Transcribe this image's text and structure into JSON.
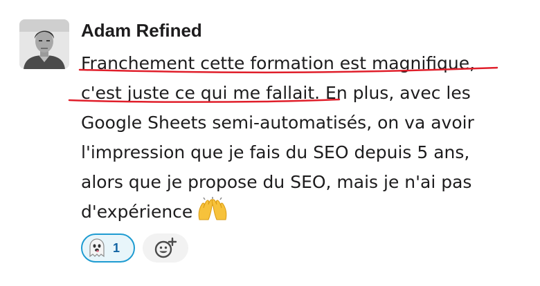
{
  "message": {
    "sender_name": "Adam Refined",
    "lines": [
      "Franchement cette formation est magnifique,",
      "c'est juste ce qui me fallait. En plus, avec les",
      "Google Sheets semi-automatisés, on va avoir",
      "l'impression que je fais du SEO depuis 5 ans,",
      "alors que je propose du SEO, mais je n'ai pas",
      "d'expérience"
    ],
    "inline_emoji": "raising-hands-emoji",
    "annotation_color": "#e01e2a"
  },
  "reactions": [
    {
      "emoji": "ghost-emoji",
      "count": "1",
      "selected": true
    }
  ],
  "add_reaction": {
    "icon": "add-emoji-icon"
  },
  "colors": {
    "pill_border": "#1d9bd1",
    "pill_background": "#e8f5fa",
    "count_text": "#1264a3",
    "text": "#1d1c1d"
  }
}
